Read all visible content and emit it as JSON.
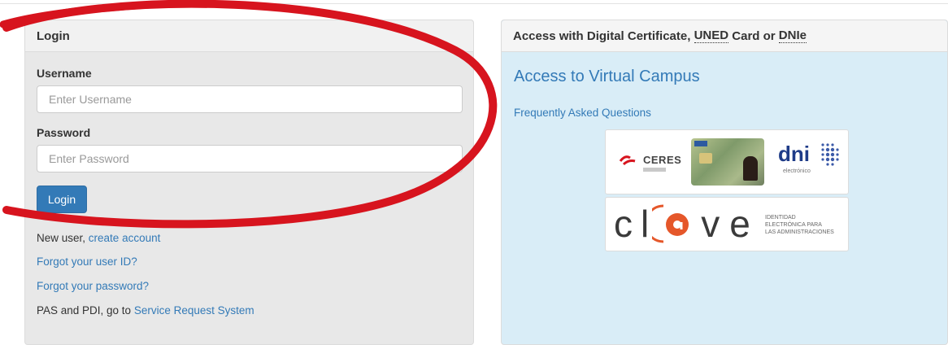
{
  "login_panel": {
    "title": "Login",
    "username_label": "Username",
    "username_placeholder": "Enter Username",
    "password_label": "Password",
    "password_placeholder": "Enter Password",
    "login_button": "Login",
    "new_user_prefix": "New user,",
    "create_account": "create account",
    "forgot_id": "Forgot your user ID?",
    "forgot_password": "Forgot your password?",
    "pas_prefix": "PAS and PDI, go to",
    "service_request": "Service Request System"
  },
  "cert_panel": {
    "title_prefix": "Access with Digital Certificate,",
    "uned": "UNED",
    "title_middle": "Card or",
    "dnie": "DNIe",
    "campus_link": "Access to Virtual Campus",
    "faq_link": "Frequently Asked Questions",
    "ceres_logo": "CERES",
    "dni_logo": "dni",
    "dni_sub": "electrónico",
    "clave_letters": [
      "c",
      "l",
      "v",
      "e"
    ],
    "clave_tagline": [
      "IDENTIDAD",
      "ELECTRÓNICA PARA",
      "LAS ADMINISTRACIONES"
    ]
  },
  "colors": {
    "link": "#337ab7",
    "annotation": "#d7141e",
    "cert_bg": "#d9edf7"
  }
}
